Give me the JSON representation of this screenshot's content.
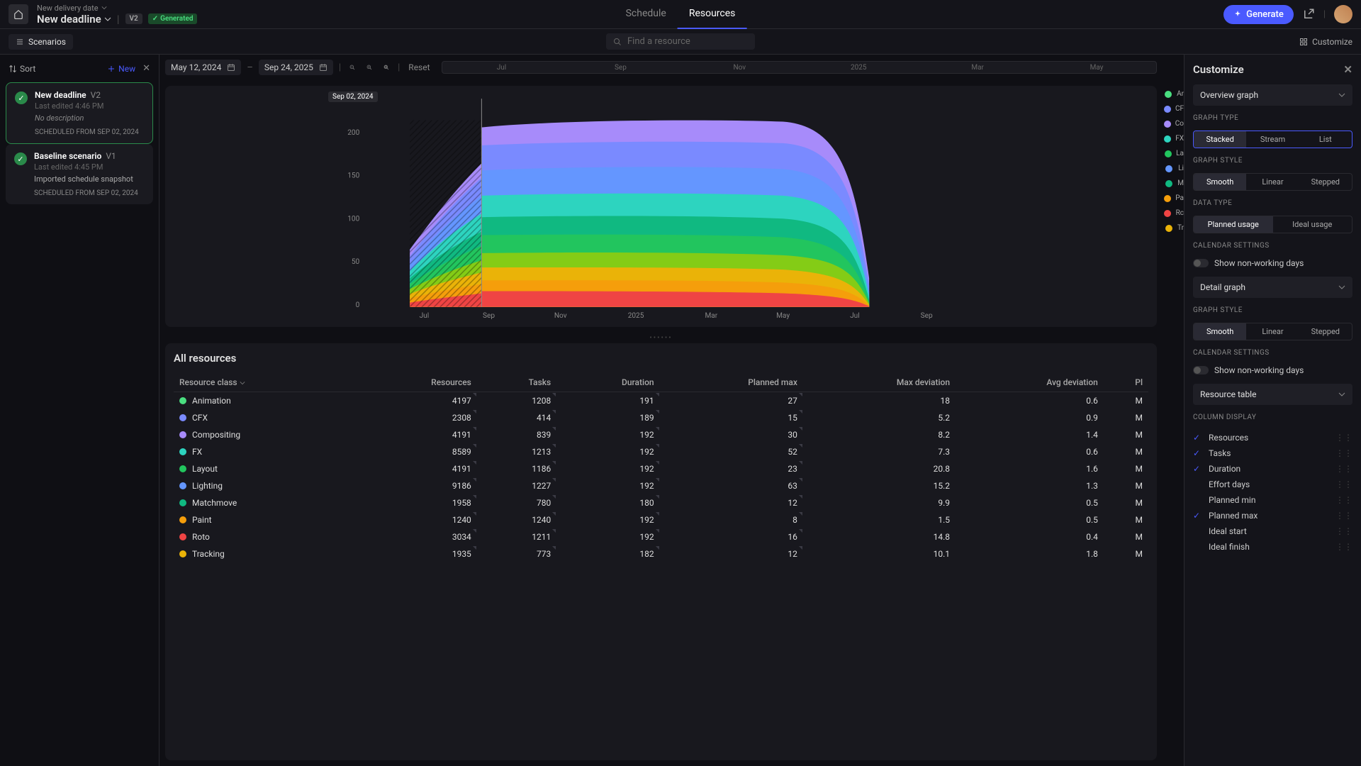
{
  "header": {
    "delivery_label": "New delivery date",
    "deadline_label": "New deadline",
    "version_badge": "V2",
    "generated_badge": "Generated",
    "nav": {
      "schedule": "Schedule",
      "resources": "Resources"
    },
    "generate_btn": "Generate"
  },
  "subheader": {
    "scenarios": "Scenarios",
    "search_placeholder": "Find a resource",
    "customize": "Customize"
  },
  "sidebar": {
    "sort": "Sort",
    "new_btn": "New",
    "scenarios": [
      {
        "title": "New deadline",
        "version": "V2",
        "edited": "Last edited 4:46 PM",
        "desc": "No description",
        "sched": "SCHEDULED FROM SEP 02, 2024",
        "desc_italic": true
      },
      {
        "title": "Baseline scenario",
        "version": "V1",
        "edited": "Last edited 4:45 PM",
        "desc": "Imported schedule snapshot",
        "sched": "SCHEDULED FROM SEP 02, 2024",
        "desc_italic": false
      }
    ]
  },
  "toolbar": {
    "date_from": "May 12, 2024",
    "date_to": "Sep 24, 2025",
    "reset": "Reset",
    "timeline_ticks": [
      "Jul",
      "Sep",
      "Nov",
      "2025",
      "Mar",
      "May"
    ]
  },
  "marker": "Sep 02, 2024",
  "chart_data": {
    "type": "area",
    "title": "",
    "ylim": [
      0,
      210
    ],
    "y_ticks": [
      0,
      50,
      100,
      150,
      200
    ],
    "x_labels": [
      "Jul",
      "Sep",
      "Nov",
      "2025",
      "Mar",
      "May",
      "Jul",
      "Sep"
    ],
    "series": [
      {
        "name": "Animation",
        "color": "#4ade80"
      },
      {
        "name": "CFX",
        "color": "#7a8aff"
      },
      {
        "name": "Compositing",
        "color": "#a78bfa"
      },
      {
        "name": "FX",
        "color": "#2dd4bf"
      },
      {
        "name": "Layout",
        "color": "#22c55e"
      },
      {
        "name": "Lighting",
        "color": "#6496ff"
      },
      {
        "name": "Matchmove",
        "color": "#10b981"
      },
      {
        "name": "Paint",
        "color": "#f59e0b"
      },
      {
        "name": "Roto",
        "color": "#ef4444"
      },
      {
        "name": "Tracking",
        "color": "#eab308"
      }
    ]
  },
  "legend": {
    "items": [
      "Ar",
      "CF",
      "Co",
      "FX",
      "La",
      "Li",
      "M",
      "Pa",
      "Rc",
      "Tr"
    ]
  },
  "table": {
    "title": "All resources",
    "columns": [
      "Resource class",
      "Resources",
      "Tasks",
      "Duration",
      "Planned max",
      "Max deviation",
      "Avg deviation",
      "Pl"
    ],
    "rows": [
      {
        "name": "Animation",
        "color": "#4ade80",
        "resources": 4197,
        "tasks": 1208,
        "duration": 191,
        "pmax": 27,
        "maxdev": 18,
        "avgdev": 0.6,
        "pl": "M"
      },
      {
        "name": "CFX",
        "color": "#7a8aff",
        "resources": 2308,
        "tasks": 414,
        "duration": 189,
        "pmax": 15,
        "maxdev": 5.2,
        "avgdev": 0.9,
        "pl": "M"
      },
      {
        "name": "Compositing",
        "color": "#a78bfa",
        "resources": 4191,
        "tasks": 839,
        "duration": 192,
        "pmax": 30,
        "maxdev": 8.2,
        "avgdev": 1.4,
        "pl": "M"
      },
      {
        "name": "FX",
        "color": "#2dd4bf",
        "resources": 8589,
        "tasks": 1213,
        "duration": 192,
        "pmax": 52,
        "maxdev": 7.3,
        "avgdev": 0.6,
        "pl": "M"
      },
      {
        "name": "Layout",
        "color": "#22c55e",
        "resources": 4191,
        "tasks": 1186,
        "duration": 192,
        "pmax": 23,
        "maxdev": 20.8,
        "avgdev": 1.6,
        "pl": "M"
      },
      {
        "name": "Lighting",
        "color": "#6496ff",
        "resources": 9186,
        "tasks": 1227,
        "duration": 192,
        "pmax": 63,
        "maxdev": 15.2,
        "avgdev": 1.3,
        "pl": "M"
      },
      {
        "name": "Matchmove",
        "color": "#10b981",
        "resources": 1958,
        "tasks": 780,
        "duration": 180,
        "pmax": 12,
        "maxdev": 9.9,
        "avgdev": 0.5,
        "pl": "M"
      },
      {
        "name": "Paint",
        "color": "#f59e0b",
        "resources": 1240,
        "tasks": 1240,
        "duration": 192,
        "pmax": 8,
        "maxdev": 1.5,
        "avgdev": 0.5,
        "pl": "M"
      },
      {
        "name": "Roto",
        "color": "#ef4444",
        "resources": 3034,
        "tasks": 1211,
        "duration": 192,
        "pmax": 16,
        "maxdev": 14.8,
        "avgdev": 0.4,
        "pl": "M"
      },
      {
        "name": "Tracking",
        "color": "#eab308",
        "resources": 1935,
        "tasks": 773,
        "duration": 182,
        "pmax": 12,
        "maxdev": 10.1,
        "avgdev": 1.8,
        "pl": "M"
      }
    ]
  },
  "customize": {
    "title": "Customize",
    "overview": "Overview graph",
    "graph_type_label": "GRAPH TYPE",
    "graph_types": [
      "Stacked",
      "Stream",
      "List"
    ],
    "graph_style_label": "GRAPH STYLE",
    "graph_styles": [
      "Smooth",
      "Linear",
      "Stepped"
    ],
    "data_type_label": "DATA TYPE",
    "data_types": [
      "Planned usage",
      "Ideal usage"
    ],
    "calendar_label": "CALENDAR SETTINGS",
    "show_nwd": "Show non-working days",
    "detail": "Detail graph",
    "resource_table": "Resource table",
    "column_display": "COLUMN DISPLAY",
    "columns": [
      {
        "name": "Resources",
        "checked": true
      },
      {
        "name": "Tasks",
        "checked": true
      },
      {
        "name": "Duration",
        "checked": true
      },
      {
        "name": "Effort days",
        "checked": false
      },
      {
        "name": "Planned min",
        "checked": false
      },
      {
        "name": "Planned max",
        "checked": true
      },
      {
        "name": "Ideal start",
        "checked": false
      },
      {
        "name": "Ideal finish",
        "checked": false
      }
    ]
  }
}
